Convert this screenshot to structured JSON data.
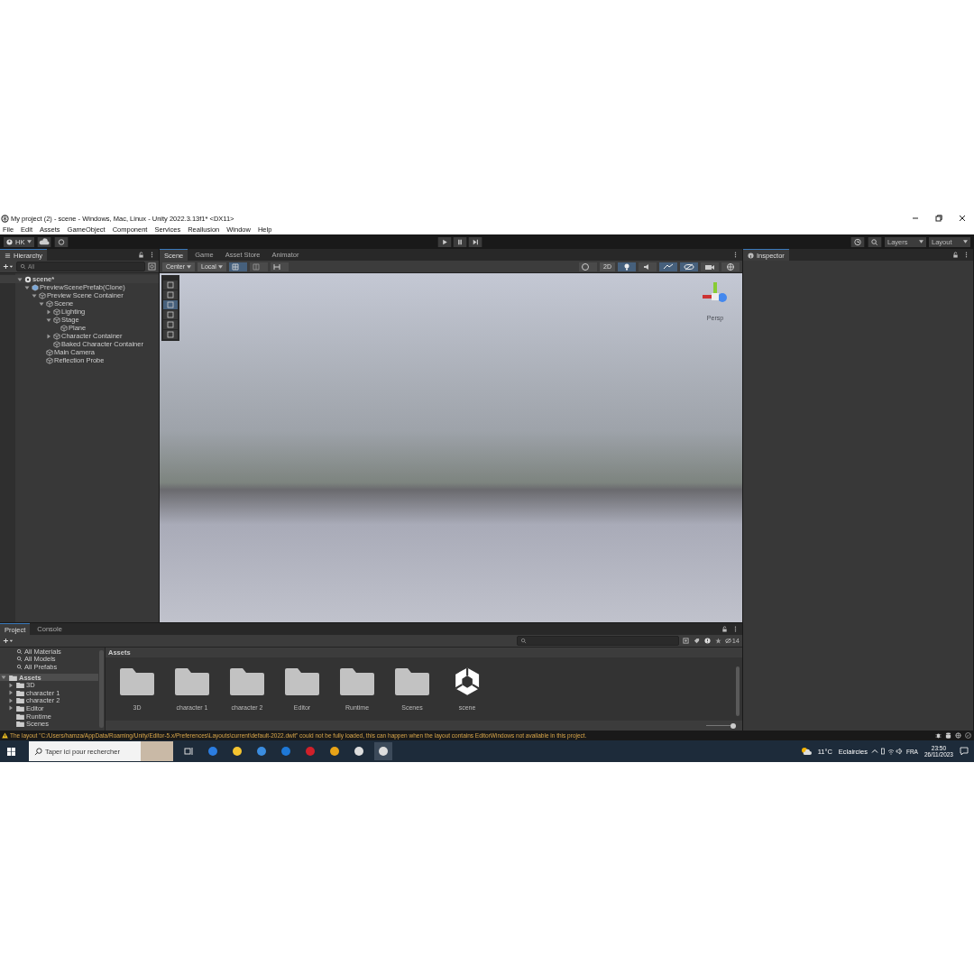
{
  "window": {
    "title": "My project (2) - scene - Windows, Mac, Linux - Unity 2022.3.13f1* <DX11>"
  },
  "menu": [
    "File",
    "Edit",
    "Assets",
    "GameObject",
    "Component",
    "Services",
    "Reallusion",
    "Window",
    "Help"
  ],
  "toolbar": {
    "account": "HK",
    "layers": "Layers",
    "layout": "Layout"
  },
  "hierarchy": {
    "tab": "Hierarchy",
    "search": {
      "placeholder": "All"
    },
    "tree": [
      {
        "label": "scene*",
        "kind": "scene",
        "expanded": true,
        "children": [
          {
            "label": "PreviewScenePrefab(Clone)",
            "kind": "prefab",
            "expanded": true,
            "children": [
              {
                "label": "Preview Scene Container",
                "kind": "object",
                "expanded": true,
                "children": [
                  {
                    "label": "Scene",
                    "kind": "object",
                    "expanded": true,
                    "children": [
                      {
                        "label": "Lighting",
                        "kind": "object",
                        "expanded": false
                      },
                      {
                        "label": "Stage",
                        "kind": "object",
                        "expanded": true,
                        "children": [
                          {
                            "label": "Plane",
                            "kind": "object"
                          }
                        ]
                      },
                      {
                        "label": "Character Container",
                        "kind": "object",
                        "expanded": false
                      },
                      {
                        "label": "Baked Character Container",
                        "kind": "object"
                      }
                    ]
                  },
                  {
                    "label": "Main Camera",
                    "kind": "object"
                  },
                  {
                    "label": "Reflection Probe",
                    "kind": "object"
                  }
                ]
              }
            ]
          }
        ]
      }
    ]
  },
  "scene": {
    "tabs": [
      {
        "label": "Scene",
        "selected": true
      },
      {
        "label": "Game",
        "selected": false
      },
      {
        "label": "Asset Store",
        "selected": false
      },
      {
        "label": "Animator",
        "selected": false
      }
    ],
    "pivot": "Center",
    "space": "Local",
    "mode_2d": "2D",
    "lighting_on": true,
    "projection": "Persp"
  },
  "inspector": {
    "tab": "Inspector"
  },
  "project": {
    "tabs": [
      {
        "label": "Project",
        "selected": true
      },
      {
        "label": "Console",
        "selected": false
      }
    ],
    "favorites": [
      "All Materials",
      "All Models",
      "All Prefabs"
    ],
    "assets": {
      "label": "Assets",
      "selected": true,
      "expanded": true,
      "children": [
        {
          "label": "3D",
          "expandable": true
        },
        {
          "label": "character 1",
          "expandable": true
        },
        {
          "label": "character 2",
          "expandable": true
        },
        {
          "label": "Editor",
          "expandable": true
        },
        {
          "label": "Runtime",
          "expandable": false
        },
        {
          "label": "Scenes",
          "expandable": false
        }
      ]
    },
    "breadcrumb": "Assets",
    "hidden_count": "14",
    "items": [
      {
        "name": "3D",
        "kind": "folder"
      },
      {
        "name": "character 1",
        "kind": "folder"
      },
      {
        "name": "character 2",
        "kind": "folder"
      },
      {
        "name": "Editor",
        "kind": "folder"
      },
      {
        "name": "Runtime",
        "kind": "folder"
      },
      {
        "name": "Scenes",
        "kind": "folder"
      },
      {
        "name": "scene",
        "kind": "scene"
      }
    ],
    "zoom": {
      "level": 1
    }
  },
  "status_bar": {
    "message": "The layout \"C:/Users/hamza/AppData/Roaming/Unity/Editor-5.x/Preferences\\Layouts\\current\\default-2022.dwlt\" could not be fully loaded, this can happen when the layout contains EditorWindows not available in this project."
  },
  "taskbar": {
    "search": {
      "placeholder": "Taper ici pour rechercher"
    },
    "temperature": "11°C",
    "weather": "Eclaircies",
    "language": "FRA",
    "time": "23:50",
    "date": "26/11/2023"
  }
}
